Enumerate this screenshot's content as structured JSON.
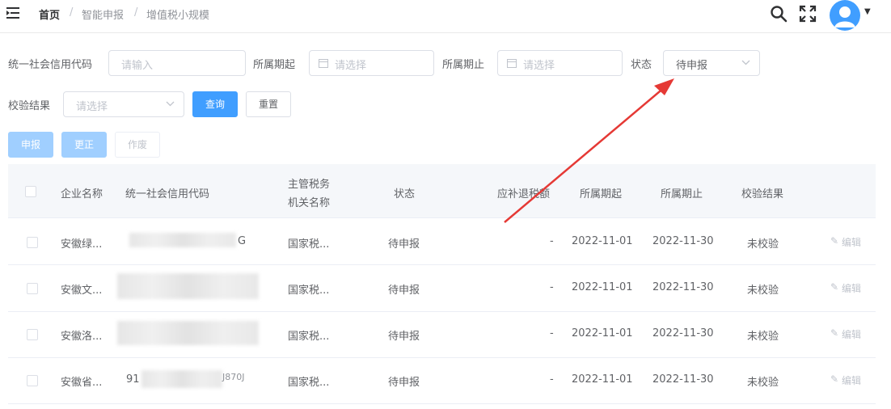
{
  "breadcrumb": {
    "home": "首页",
    "sep": "/",
    "level2": "智能申报",
    "level3": "增值税小规模"
  },
  "icons": {
    "menu": "menu-fold-icon",
    "search": "search-icon",
    "fullscreen": "fullscreen-icon",
    "avatar": "user-avatar-icon",
    "caret": "caret-down-icon"
  },
  "filters": {
    "credit_code_label": "统一社会信用代码",
    "credit_code_placeholder": "请输入",
    "period_start_label": "所属期起",
    "period_start_placeholder": "请选择",
    "period_end_label": "所属期止",
    "period_end_placeholder": "请选择",
    "status_label": "状态",
    "status_value": "待申报",
    "check_label": "校验结果",
    "check_placeholder": "请选择",
    "query_button": "查询",
    "reset_button": "重置"
  },
  "actions": {
    "declare": "申报",
    "correct": "更正",
    "void": "作废"
  },
  "table": {
    "headers": {
      "company": "企业名称",
      "credit_code": "统一社会信用代码",
      "tax_authority_line1": "主管税务",
      "tax_authority_line2": "机关名称",
      "status": "状态",
      "refund": "应补退税额",
      "period_start": "所属期起",
      "period_end": "所属期止",
      "check_result": "校验结果"
    },
    "rows": [
      {
        "company": "安徽绿...",
        "credit_code_visible": "G",
        "tax_authority": "国家税...",
        "status": "待申报",
        "refund": "-",
        "period_start": "2022-11-01",
        "period_end": "2022-11-30",
        "check_result": "未校验",
        "edit": "编辑"
      },
      {
        "company": "安徽文...",
        "credit_code_visible": "",
        "tax_authority": "国家税...",
        "status": "待申报",
        "refund": "-",
        "period_start": "2022-11-01",
        "period_end": "2022-11-30",
        "check_result": "未校验",
        "edit": "编辑"
      },
      {
        "company": "安徽洛...",
        "credit_code_visible": "",
        "tax_authority": "国家税...",
        "status": "待申报",
        "refund": "-",
        "period_start": "2022-11-01",
        "period_end": "2022-11-30",
        "check_result": "未校验",
        "edit": "编辑"
      },
      {
        "company": "安徽省...",
        "credit_code_visible": "91",
        "credit_code_tail": "J870J",
        "tax_authority": "国家税...",
        "status": "待申报",
        "refund": "-",
        "period_start": "2022-11-01",
        "period_end": "2022-11-30",
        "check_result": "未校验",
        "edit": "编辑"
      }
    ]
  },
  "annotation_color": "#e53935",
  "accent_color": "#409eff"
}
